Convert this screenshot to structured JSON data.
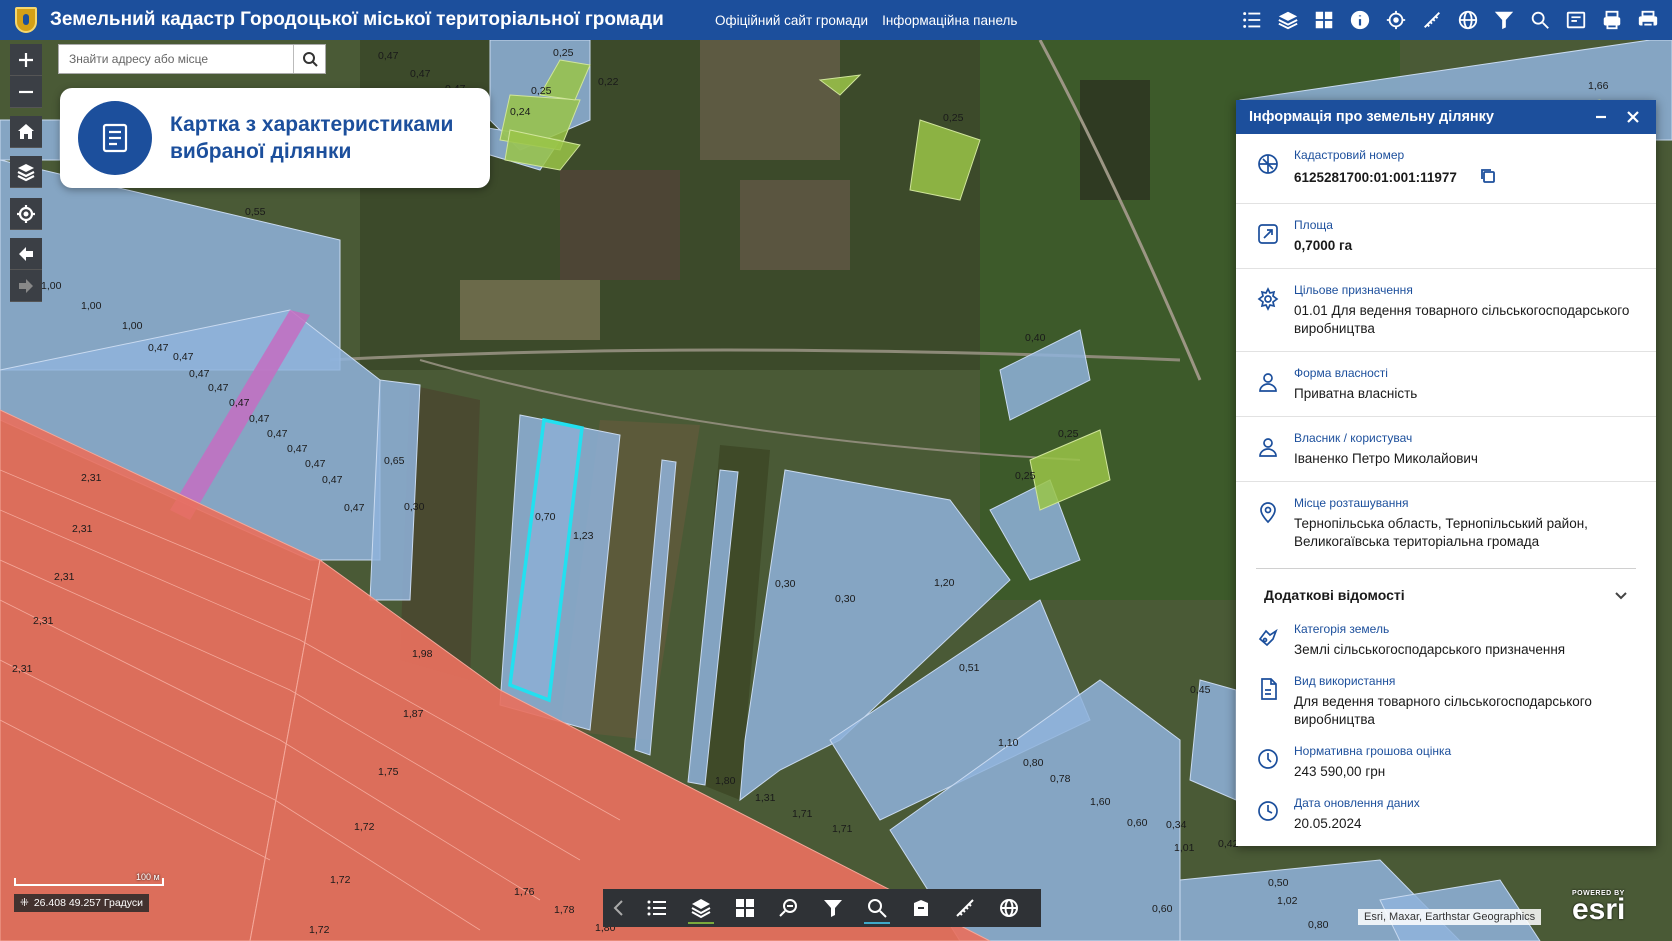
{
  "app": {
    "title": "Земельний кадастр Городоцької міської територіальної громади",
    "links": [
      "Офіційний сайт громади",
      "Інформаційна панель"
    ]
  },
  "toolbar_icons": [
    "list-icon",
    "layers-icon",
    "grid-icon",
    "info-icon",
    "locate-icon",
    "measure-icon",
    "globe-icon",
    "filter-icon",
    "zoom-search-icon",
    "print-map-icon",
    "print-icon",
    "printer-icon"
  ],
  "search": {
    "placeholder": "Знайти адресу або місце"
  },
  "card": {
    "title_line1": "Картка з характеристиками",
    "title_line2": "вибраної ділянки"
  },
  "panel": {
    "title": "Інформація про земельну ділянку",
    "cadastral_label": "Кадастровий номер",
    "cadastral_value": "6125281700:01:001:11977",
    "area_label": "Площа",
    "area_value": "0,7000 га",
    "purpose_label": "Цільове призначення",
    "purpose_value": "01.01 Для ведення товарного сільськогосподарського виробництва",
    "ownership_label": "Форма власності",
    "ownership_value": "Приватна власність",
    "owner_label": "Власник / користувач",
    "owner_value": "Іваненко Петро Миколайович",
    "location_label": "Місце розташування",
    "location_value": "Тернопільська область, Тернопільський район, Великогаївська територіальна громада",
    "extra_title": "Додаткові відомості",
    "category_label": "Категорія земель",
    "category_value": "Землі сільськогосподарського призначення",
    "usage_label": "Вид використання",
    "usage_value": "Для ведення товарного сільськогосподарського виробництва",
    "valuation_label": "Нормативна грошова оцінка",
    "valuation_value": "243 590,00 грн",
    "updated_label": "Дата оновлення даних",
    "updated_value": "20.05.2024"
  },
  "map": {
    "scale_text": "100 м",
    "coords": "26.408 49.257 Градуси",
    "attribution": "Esri, Maxar, Earthstar Geographics",
    "esri_powered": "POWERED BY",
    "esri_name": "esri",
    "parcel_labels": [
      "0,47",
      "0,47",
      "0,47",
      "0,25",
      "0,22",
      "0,25",
      "0,24",
      "0,25",
      "1,66",
      "0,55",
      "1,00",
      "1,00",
      "1,00",
      "0,47",
      "0,47",
      "0,47",
      "0,47",
      "0,47",
      "0,47",
      "0,47",
      "0,47",
      "0,47",
      "0,47",
      "0,65",
      "0,30",
      "0,47",
      "0,70",
      "1,23",
      "0,40",
      "0,25",
      "0,25",
      "2,31",
      "2,31",
      "2,31",
      "2,31",
      "2,31",
      "1,98",
      "1,87",
      "1,75",
      "1,72",
      "1,72",
      "1,76",
      "1,78",
      "1,72",
      "1,80",
      "0,30",
      "0,30",
      "1,20",
      "0,51",
      "1,10",
      "0,80",
      "0,78",
      "1,60",
      "0,60",
      "0,34",
      "1,01",
      "1,80",
      "1,31",
      "1,71",
      "1,71",
      "0,50",
      "1,02",
      "0,60",
      "0,80",
      "0,42",
      "0,45"
    ]
  },
  "bottom_toolbar": [
    "chevron-left-icon",
    "list-icon",
    "layers-icon",
    "grid-icon",
    "zoom-search-icon",
    "filter-icon",
    "search-icon",
    "print-map-icon",
    "measure-icon",
    "globe-icon"
  ],
  "colors": {
    "primary": "#1c4f9c",
    "parcel_blue": "#8fb3dc",
    "parcel_red": "#e8705e",
    "selection": "#22e0f0"
  }
}
